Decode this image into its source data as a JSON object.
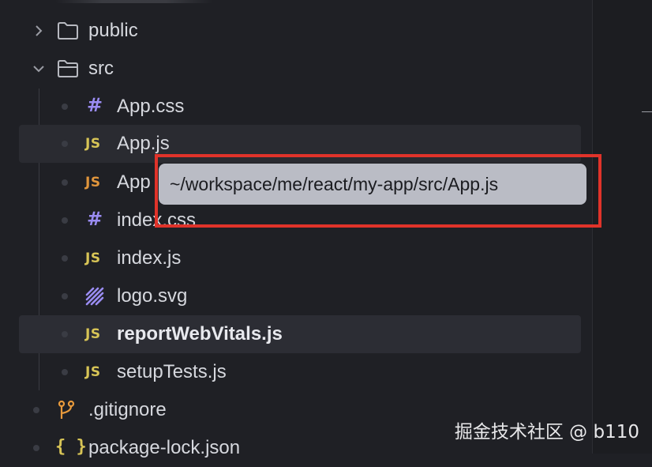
{
  "explorer": {
    "items": [
      {
        "name": "public",
        "kind": "folder",
        "expanded": false
      },
      {
        "name": "src",
        "kind": "folder",
        "expanded": true
      },
      {
        "name": "App.css",
        "kind": "css",
        "icon_text": "#"
      },
      {
        "name": "App.js",
        "kind": "js",
        "icon_text": "JS"
      },
      {
        "name": "App",
        "kind": "js",
        "icon_text": "JS"
      },
      {
        "name": "index.css",
        "kind": "css",
        "icon_text": "#"
      },
      {
        "name": "index.js",
        "kind": "js",
        "icon_text": "JS"
      },
      {
        "name": "logo.svg",
        "kind": "svg"
      },
      {
        "name": "reportWebVitals.js",
        "kind": "js",
        "icon_text": "JS"
      },
      {
        "name": "setupTests.js",
        "kind": "js",
        "icon_text": "JS"
      },
      {
        "name": ".gitignore",
        "kind": "git"
      },
      {
        "name": "package-lock.json",
        "kind": "json",
        "icon_text": "{ }"
      }
    ]
  },
  "tooltip": {
    "text": "~/workspace/me/react/my-app/src/App.js"
  },
  "watermark": {
    "text": "掘金技术社区 @ b110"
  },
  "colors": {
    "background": "#1f2025",
    "js_icon": "#d7c456",
    "css_icon": "#9a8cf2",
    "git_icon": "#e89a3c",
    "tooltip_bg": "#babcc5",
    "annotation": "#e0332a"
  }
}
